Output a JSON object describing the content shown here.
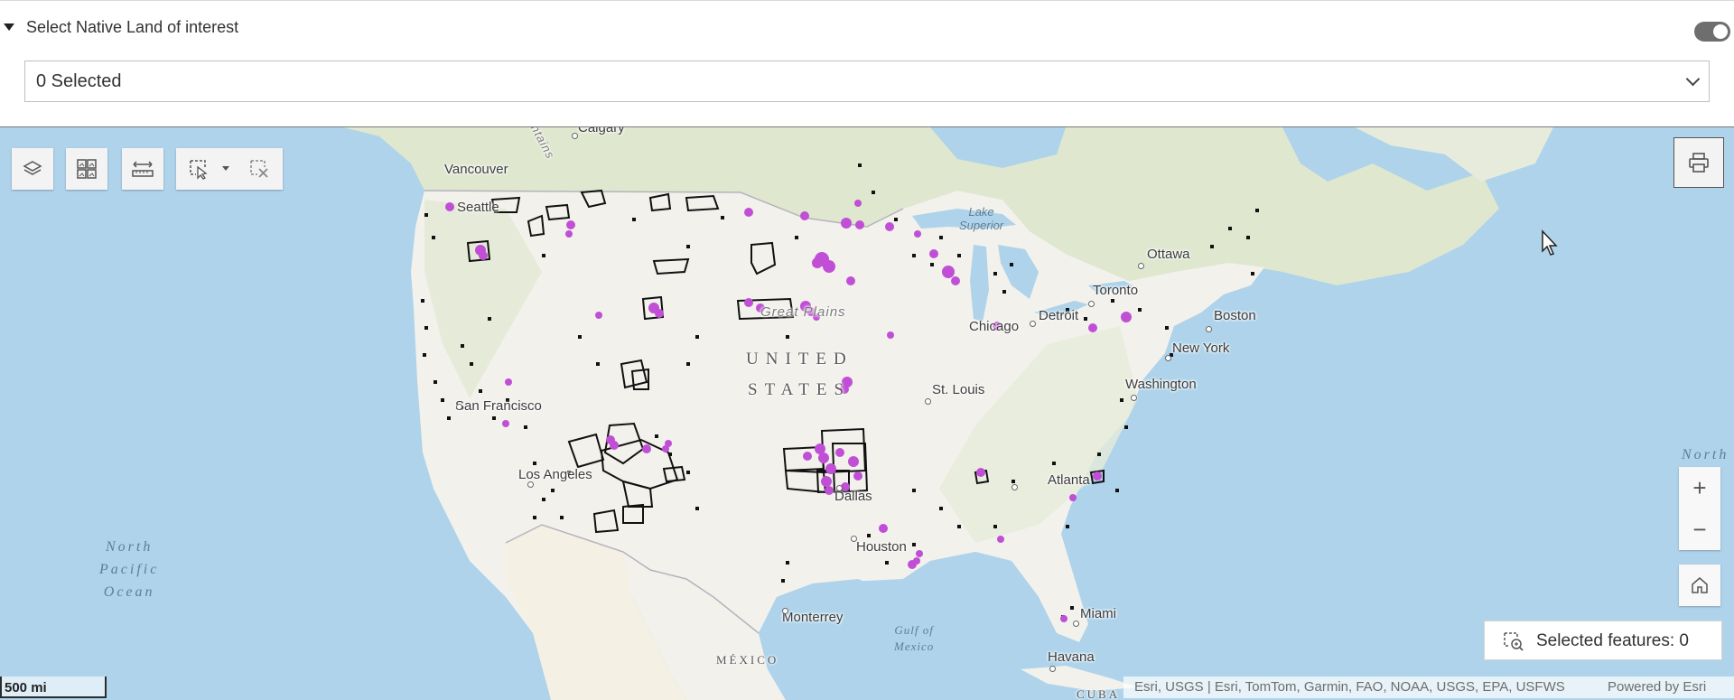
{
  "filter": {
    "title": "Select Native Land of interest",
    "toggle_on": true,
    "select_value": "0 Selected"
  },
  "toolbar": {
    "layers_icon": "layers-icon",
    "basemap_icon": "basemap-gallery-icon",
    "measure_icon": "measure-icon",
    "select_icon": "select-tool-icon",
    "dropdown_icon": "chevron-down-icon",
    "clear_icon": "clear-selection-icon",
    "print_icon": "print-icon"
  },
  "map": {
    "country_label": "UNITED STATES",
    "country_line1": "UNITED",
    "country_line2": "STATES",
    "region_label": "Great Plains",
    "ocean_pacific": [
      "North",
      "Pacific",
      "Ocean"
    ],
    "ocean_atlantic": "North",
    "gulf": [
      "Gulf of",
      "Mexico"
    ],
    "lake_superior": [
      "Lake",
      "Superior"
    ],
    "mexico": "MÉXICO",
    "cuba": "CUBA",
    "cities": {
      "calgary": "Calgary",
      "vancouver": "Vancouver",
      "seattle": "Seattle",
      "ottawa": "Ottawa",
      "toronto": "Toronto",
      "detroit": "Detroit",
      "chicago": "Chicago",
      "boston": "Boston",
      "new_york": "New York",
      "washington": "Washington",
      "st_louis": "St. Louis",
      "san_francisco": "San Francisco",
      "los_angeles": "Los Angeles",
      "dallas": "Dallas",
      "houston": "Houston",
      "atlanta": "Atlanta",
      "miami": "Miami",
      "monterrey": "Monterrey",
      "havana": "Havana"
    },
    "mountains_fragment": "Mountains"
  },
  "zoom": {
    "in": "+",
    "out": "−",
    "home_icon": "home-icon"
  },
  "selected_features": {
    "label": "Selected features: 0",
    "icon": "select-zoom-icon"
  },
  "scale": "500 mi",
  "attribution": {
    "sources": "Esri, USGS | Esri, TomTom, Garmin, FAO, NOAA, USGS, EPA, USFWS",
    "powered": "Powered by Esri"
  },
  "colors": {
    "water": "#aed3ea",
    "land": "#f2f1ec",
    "canada_green": "#dfe7cf",
    "feature_fill": "#c04fd6",
    "feature_outline": "#111111"
  }
}
